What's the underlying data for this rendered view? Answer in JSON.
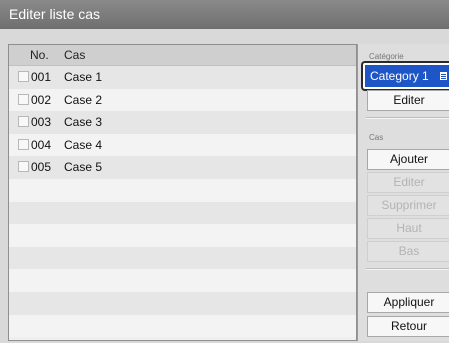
{
  "window": {
    "title": "Editer liste cas"
  },
  "table": {
    "columns": {
      "no": "No.",
      "cas": "Cas"
    },
    "rows": [
      {
        "no": "001",
        "cas": "Case 1"
      },
      {
        "no": "002",
        "cas": "Case 2"
      },
      {
        "no": "003",
        "cas": "Case 3"
      },
      {
        "no": "004",
        "cas": "Case 4"
      },
      {
        "no": "005",
        "cas": "Case 5"
      }
    ],
    "empty_rows": 7
  },
  "sidebar": {
    "category_label": "Catégorie",
    "category_value": "Category 1",
    "category_edit": "Editer",
    "cas_label": "Cas",
    "ajouter": "Ajouter",
    "editer": "Editer",
    "supprimer": "Supprimer",
    "haut": "Haut",
    "bas": "Bas",
    "appliquer": "Appliquer",
    "retour": "Retour"
  },
  "colors": {
    "selection": "#1e56c7",
    "titlebar": "#7a7a7a"
  },
  "icons": {
    "category_dropdown": "list-icon"
  }
}
